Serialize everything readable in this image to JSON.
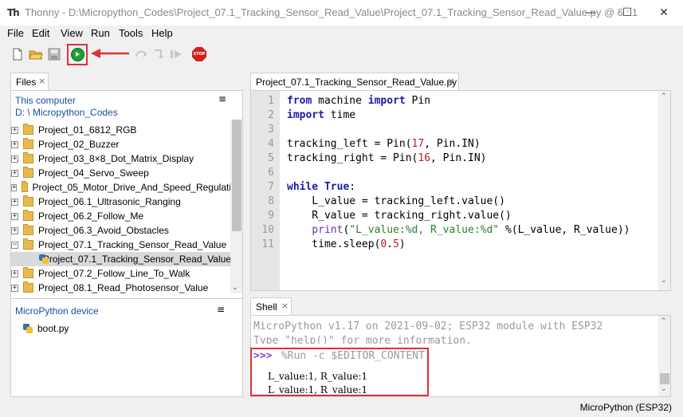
{
  "window": {
    "title": "Thonny  -  D:\\Micropython_Codes\\Project_07.1_Tracking_Sensor_Read_Value\\Project_07.1_Tracking_Sensor_Read_Value.py  @  6 : 1",
    "minimize": "—",
    "maximize": "☐",
    "close": "✕"
  },
  "menu": [
    "File",
    "Edit",
    "View",
    "Run",
    "Tools",
    "Help"
  ],
  "toolbar": {
    "stop_label": "STOP"
  },
  "files": {
    "tab_label": "Files",
    "tab_close": "×",
    "this_computer_label": "This computer",
    "path": "D: \\ Micropython_Codes",
    "menu_glyph": "≡",
    "items": [
      "Project_01_6812_RGB",
      "Project_02_Buzzer",
      "Project_03_8×8_Dot_Matrix_Display",
      "Project_04_Servo_Sweep",
      "Project_05_Motor_Drive_And_Speed_Regulati",
      "Project_06.1_Ultrasonic_Ranging",
      "Project_06.2_Follow_Me",
      "Project_06.3_Avoid_Obstacles",
      "Project_07.1_Tracking_Sensor_Read_Value",
      "Project_07.2_Follow_Line_To_Walk",
      "Project_08.1_Read_Photosensor_Value"
    ],
    "selected_file": "Project_07.1_Tracking_Sensor_Read_Value",
    "device_label": "MicroPython device",
    "device_files": [
      "boot.py"
    ]
  },
  "editor": {
    "tab_label": "Project_07.1_Tracking_Sensor_Read_Value.py",
    "tab_close": "×",
    "line_numbers": [
      "1",
      "2",
      "3",
      "4",
      "5",
      "6",
      "7",
      "8",
      "9",
      "10",
      "11"
    ],
    "lines": [
      "from machine import Pin",
      "import time",
      "",
      "tracking_left = Pin(17, Pin.IN)",
      "tracking_right = Pin(16, Pin.IN)",
      "",
      "while True:",
      "    L_value = tracking_left.value()",
      "    R_value = tracking_right.value()",
      "    print(\"L_value:%d, R_value:%d\" %(L_value, R_value))",
      "    time.sleep(0.5)"
    ]
  },
  "shell": {
    "tab_label": "Shell",
    "tab_close": "×",
    "banner": "MicroPython v1.17 on 2021-09-02; ESP32 module with ESP32",
    "help_line": "Type \"help()\" for more information.",
    "prompt": ">>>",
    "command": " %Run -c $EDITOR_CONTENT",
    "outputs": [
      "L_value:1, R_value:1",
      "L_value:1, R_value:1"
    ]
  },
  "status": {
    "interpreter": "MicroPython (ESP32)"
  },
  "colors": {
    "highlight_red": "#e0303a",
    "keyword_blue": "#1b1bb0",
    "run_green": "#1e9f2f"
  }
}
